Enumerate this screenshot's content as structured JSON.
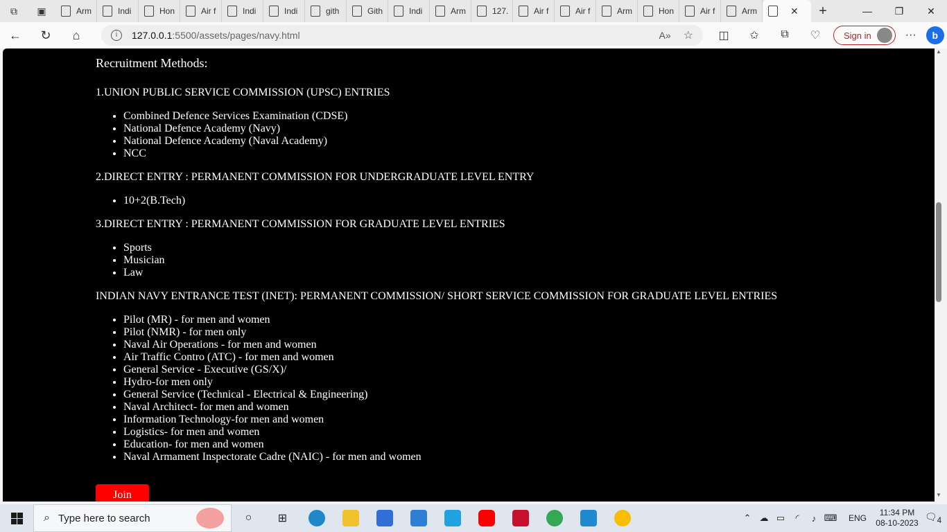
{
  "browser": {
    "tabs": [
      {
        "label": "Arm"
      },
      {
        "label": "Indi"
      },
      {
        "label": "Hon"
      },
      {
        "label": "Air f"
      },
      {
        "label": "Indi"
      },
      {
        "label": "Indi"
      },
      {
        "label": "gith"
      },
      {
        "label": "Gith"
      },
      {
        "label": "Indi"
      },
      {
        "label": "Arm"
      },
      {
        "label": "127."
      },
      {
        "label": "Air f"
      },
      {
        "label": "Air f"
      },
      {
        "label": "Arm"
      },
      {
        "label": "Hon"
      },
      {
        "label": "Air f"
      },
      {
        "label": "Arm"
      }
    ],
    "url_host": "127.0.0.1",
    "url_path": ":5500/assets/pages/navy.html",
    "signin_label": "Sign in"
  },
  "page": {
    "heading": "Recruitment Methods:",
    "sections": [
      {
        "title": "1.UNION PUBLIC SERVICE COMMISSION (UPSC) ENTRIES",
        "items": [
          "Combined Defence Services Examination (CDSE)",
          "National Defence Academy (Navy)",
          "National Defence Academy (Naval Academy)",
          "NCC"
        ]
      },
      {
        "title": "2.DIRECT ENTRY : PERMANENT COMMISSION FOR UNDERGRADUATE LEVEL ENTRY",
        "items": [
          "10+2(B.Tech)"
        ]
      },
      {
        "title": "3.DIRECT ENTRY : PERMANENT COMMISSION FOR GRADUATE LEVEL ENTRIES",
        "items": [
          "Sports",
          "Musician",
          "Law"
        ]
      },
      {
        "title": "INDIAN NAVY ENTRANCE TEST (INET): PERMANENT COMMISSION/ SHORT SERVICE COMMISSION FOR GRADUATE LEVEL ENTRIES",
        "items": [
          "Pilot (MR) - for men and women",
          "Pilot (NMR) - for men only",
          "Naval Air Operations - for men and women",
          "Air Traffic Contro (ATC) - for men and women",
          "General Service - Executive (GS/X)/",
          "Hydro-for men only",
          "General Service (Technical - Electrical & Engineering)",
          "Naval Architect- for men and women",
          "Information Technology-for men and women",
          "Logistics- for men and women",
          "Education- for men and women",
          "Naval Armament Inspectorate Cadre (NAIC) - for men and women"
        ]
      }
    ],
    "join_label": "Join"
  },
  "taskbar": {
    "search_placeholder": "Type here to search",
    "language": "ENG",
    "time": "11:34 PM",
    "date": "08-10-2023",
    "notification_count": "4"
  },
  "colors": {
    "page_background": "#000000",
    "join_button": "#ff0000",
    "signin_accent": "#b0272b"
  }
}
